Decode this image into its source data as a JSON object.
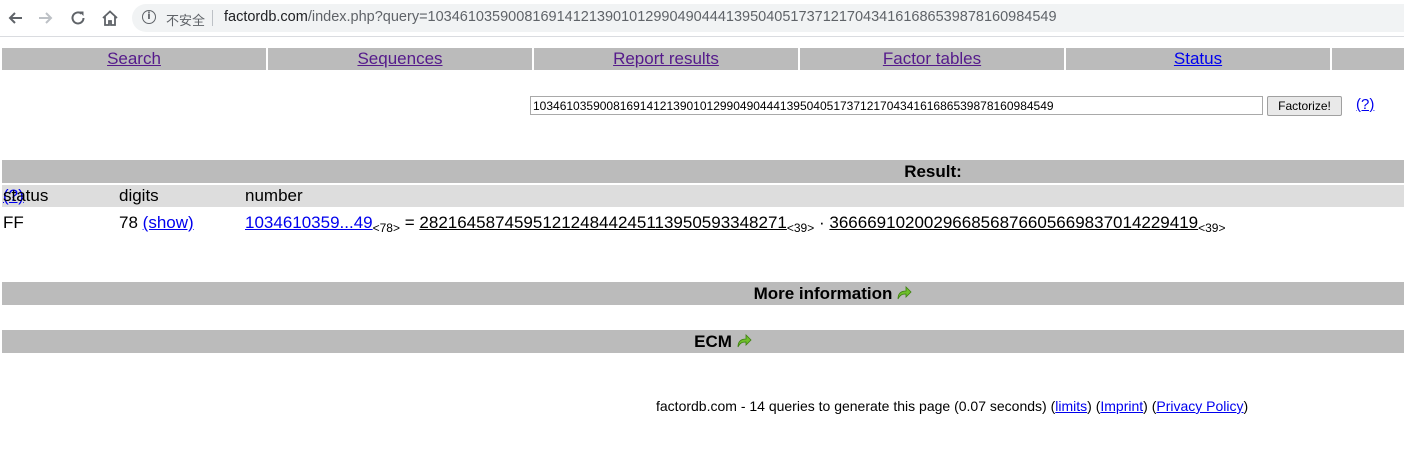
{
  "browser": {
    "security_label": "不安全",
    "url_host": "factordb.com",
    "url_path": "/index.php?query=1034610359008169141213901012990490444139504051737121704341616865398781609845​49"
  },
  "nav": {
    "items": [
      {
        "label": "Search"
      },
      {
        "label": "Sequences"
      },
      {
        "label": "Report results"
      },
      {
        "label": "Factor tables"
      },
      {
        "label": "Status"
      }
    ]
  },
  "search": {
    "query_value": "103461035900816914121390101299049044413950405173712170434161686539878160984549",
    "submit_label": "Factorize!",
    "help_label": "(?)"
  },
  "result": {
    "title": "Result:",
    "headers": {
      "status": "status",
      "status_help": "(?)",
      "digits": "digits",
      "number": "number"
    },
    "row": {
      "status": "FF",
      "digits": "78",
      "show_label": "(show)",
      "number_short": "1034610359...49",
      "number_len": "<78>",
      "equals": "=",
      "factor1": "282164587459512124844245113950593348271",
      "factor1_len": "<39>",
      "dot": "·",
      "factor2": "366669102002966856876605669837014229419",
      "factor2_len": "<39>"
    }
  },
  "sections": {
    "more_info": "More information",
    "ecm": "ECM"
  },
  "footer": {
    "text": "factordb.com - 14 queries to generate this page (0.07 seconds)",
    "limits": "limits",
    "imprint": "Imprint",
    "privacy": "Privacy Policy"
  }
}
